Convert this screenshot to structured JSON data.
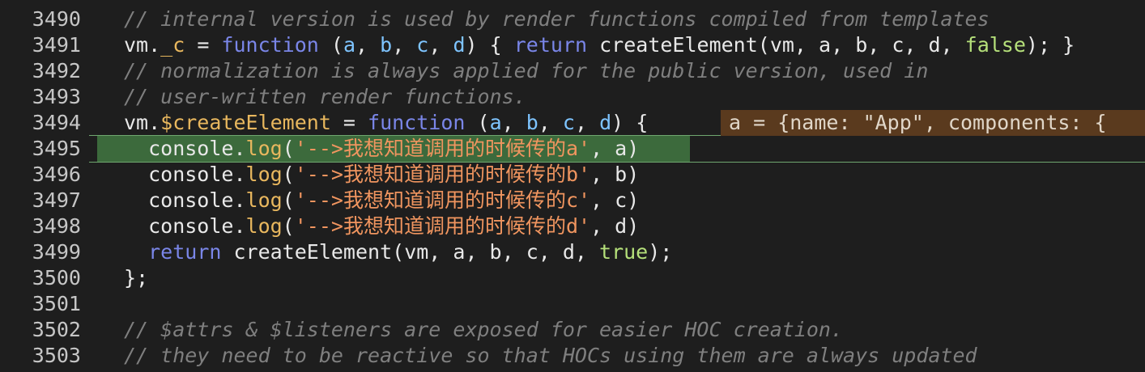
{
  "colors": {
    "background": "#1e1e1e",
    "highlight_fill": "#3c6a3c",
    "highlight_border": "#6fa76f",
    "hint_background": "#5a3a1e"
  },
  "inline_hint": {
    "text": "a = {name: \"App\", components: {"
  },
  "lines": [
    {
      "number": "3490",
      "tokens": [
        {
          "t": "comment",
          "v": "// internal version is used by render functions compiled from templates"
        }
      ]
    },
    {
      "number": "3491",
      "tokens": [
        {
          "t": "plain",
          "v": "vm."
        },
        {
          "t": "method",
          "v": "_c"
        },
        {
          "t": "plain",
          "v": " = "
        },
        {
          "t": "keyword",
          "v": "function"
        },
        {
          "t": "plain",
          "v": " ("
        },
        {
          "t": "param",
          "v": "a"
        },
        {
          "t": "plain",
          "v": ", "
        },
        {
          "t": "param",
          "v": "b"
        },
        {
          "t": "plain",
          "v": ", "
        },
        {
          "t": "param",
          "v": "c"
        },
        {
          "t": "plain",
          "v": ", "
        },
        {
          "t": "param",
          "v": "d"
        },
        {
          "t": "plain",
          "v": ") { "
        },
        {
          "t": "keyword",
          "v": "return"
        },
        {
          "t": "plain",
          "v": " createElement(vm, a, b, c, d, "
        },
        {
          "t": "bool",
          "v": "false"
        },
        {
          "t": "plain",
          "v": "); }"
        }
      ]
    },
    {
      "number": "3492",
      "tokens": [
        {
          "t": "comment",
          "v": "// normalization is always applied for the public version, used in"
        }
      ]
    },
    {
      "number": "3493",
      "tokens": [
        {
          "t": "comment",
          "v": "// user-written render functions."
        }
      ]
    },
    {
      "number": "3494",
      "tokens": [
        {
          "t": "plain",
          "v": "vm."
        },
        {
          "t": "method",
          "v": "$createElement"
        },
        {
          "t": "plain",
          "v": " = "
        },
        {
          "t": "keyword",
          "v": "function"
        },
        {
          "t": "plain",
          "v": " ("
        },
        {
          "t": "param",
          "v": "a"
        },
        {
          "t": "plain",
          "v": ", "
        },
        {
          "t": "param",
          "v": "b"
        },
        {
          "t": "plain",
          "v": ", "
        },
        {
          "t": "param",
          "v": "c"
        },
        {
          "t": "plain",
          "v": ", "
        },
        {
          "t": "param",
          "v": "d"
        },
        {
          "t": "plain",
          "v": ") {"
        }
      ]
    },
    {
      "number": "3495",
      "tokens": [
        {
          "t": "plain",
          "v": "  console."
        },
        {
          "t": "method",
          "v": "log"
        },
        {
          "t": "plain",
          "v": "("
        },
        {
          "t": "string",
          "v": "'-->我想知道调用的时候传的a'"
        },
        {
          "t": "plain",
          "v": ", a)"
        }
      ]
    },
    {
      "number": "3496",
      "tokens": [
        {
          "t": "plain",
          "v": "  console."
        },
        {
          "t": "method",
          "v": "log"
        },
        {
          "t": "plain",
          "v": "("
        },
        {
          "t": "string",
          "v": "'-->我想知道调用的时候传的b'"
        },
        {
          "t": "plain",
          "v": ", b)"
        }
      ]
    },
    {
      "number": "3497",
      "tokens": [
        {
          "t": "plain",
          "v": "  console."
        },
        {
          "t": "method",
          "v": "log"
        },
        {
          "t": "plain",
          "v": "("
        },
        {
          "t": "string",
          "v": "'-->我想知道调用的时候传的c'"
        },
        {
          "t": "plain",
          "v": ", c)"
        }
      ]
    },
    {
      "number": "3498",
      "tokens": [
        {
          "t": "plain",
          "v": "  console."
        },
        {
          "t": "method",
          "v": "log"
        },
        {
          "t": "plain",
          "v": "("
        },
        {
          "t": "string",
          "v": "'-->我想知道调用的时候传的d'"
        },
        {
          "t": "plain",
          "v": ", d)"
        }
      ]
    },
    {
      "number": "3499",
      "tokens": [
        {
          "t": "plain",
          "v": "  "
        },
        {
          "t": "keyword",
          "v": "return"
        },
        {
          "t": "plain",
          "v": " createElement(vm, a, b, c, d, "
        },
        {
          "t": "bool",
          "v": "true"
        },
        {
          "t": "plain",
          "v": ");"
        }
      ]
    },
    {
      "number": "3500",
      "tokens": [
        {
          "t": "plain",
          "v": "};"
        }
      ]
    },
    {
      "number": "3501",
      "tokens": []
    },
    {
      "number": "3502",
      "tokens": [
        {
          "t": "comment",
          "v": "// $attrs & $listeners are exposed for easier HOC creation."
        }
      ]
    },
    {
      "number": "3503",
      "tokens": [
        {
          "t": "comment",
          "v": "// they need to be reactive so that HOCs using them are always updated"
        }
      ]
    }
  ]
}
